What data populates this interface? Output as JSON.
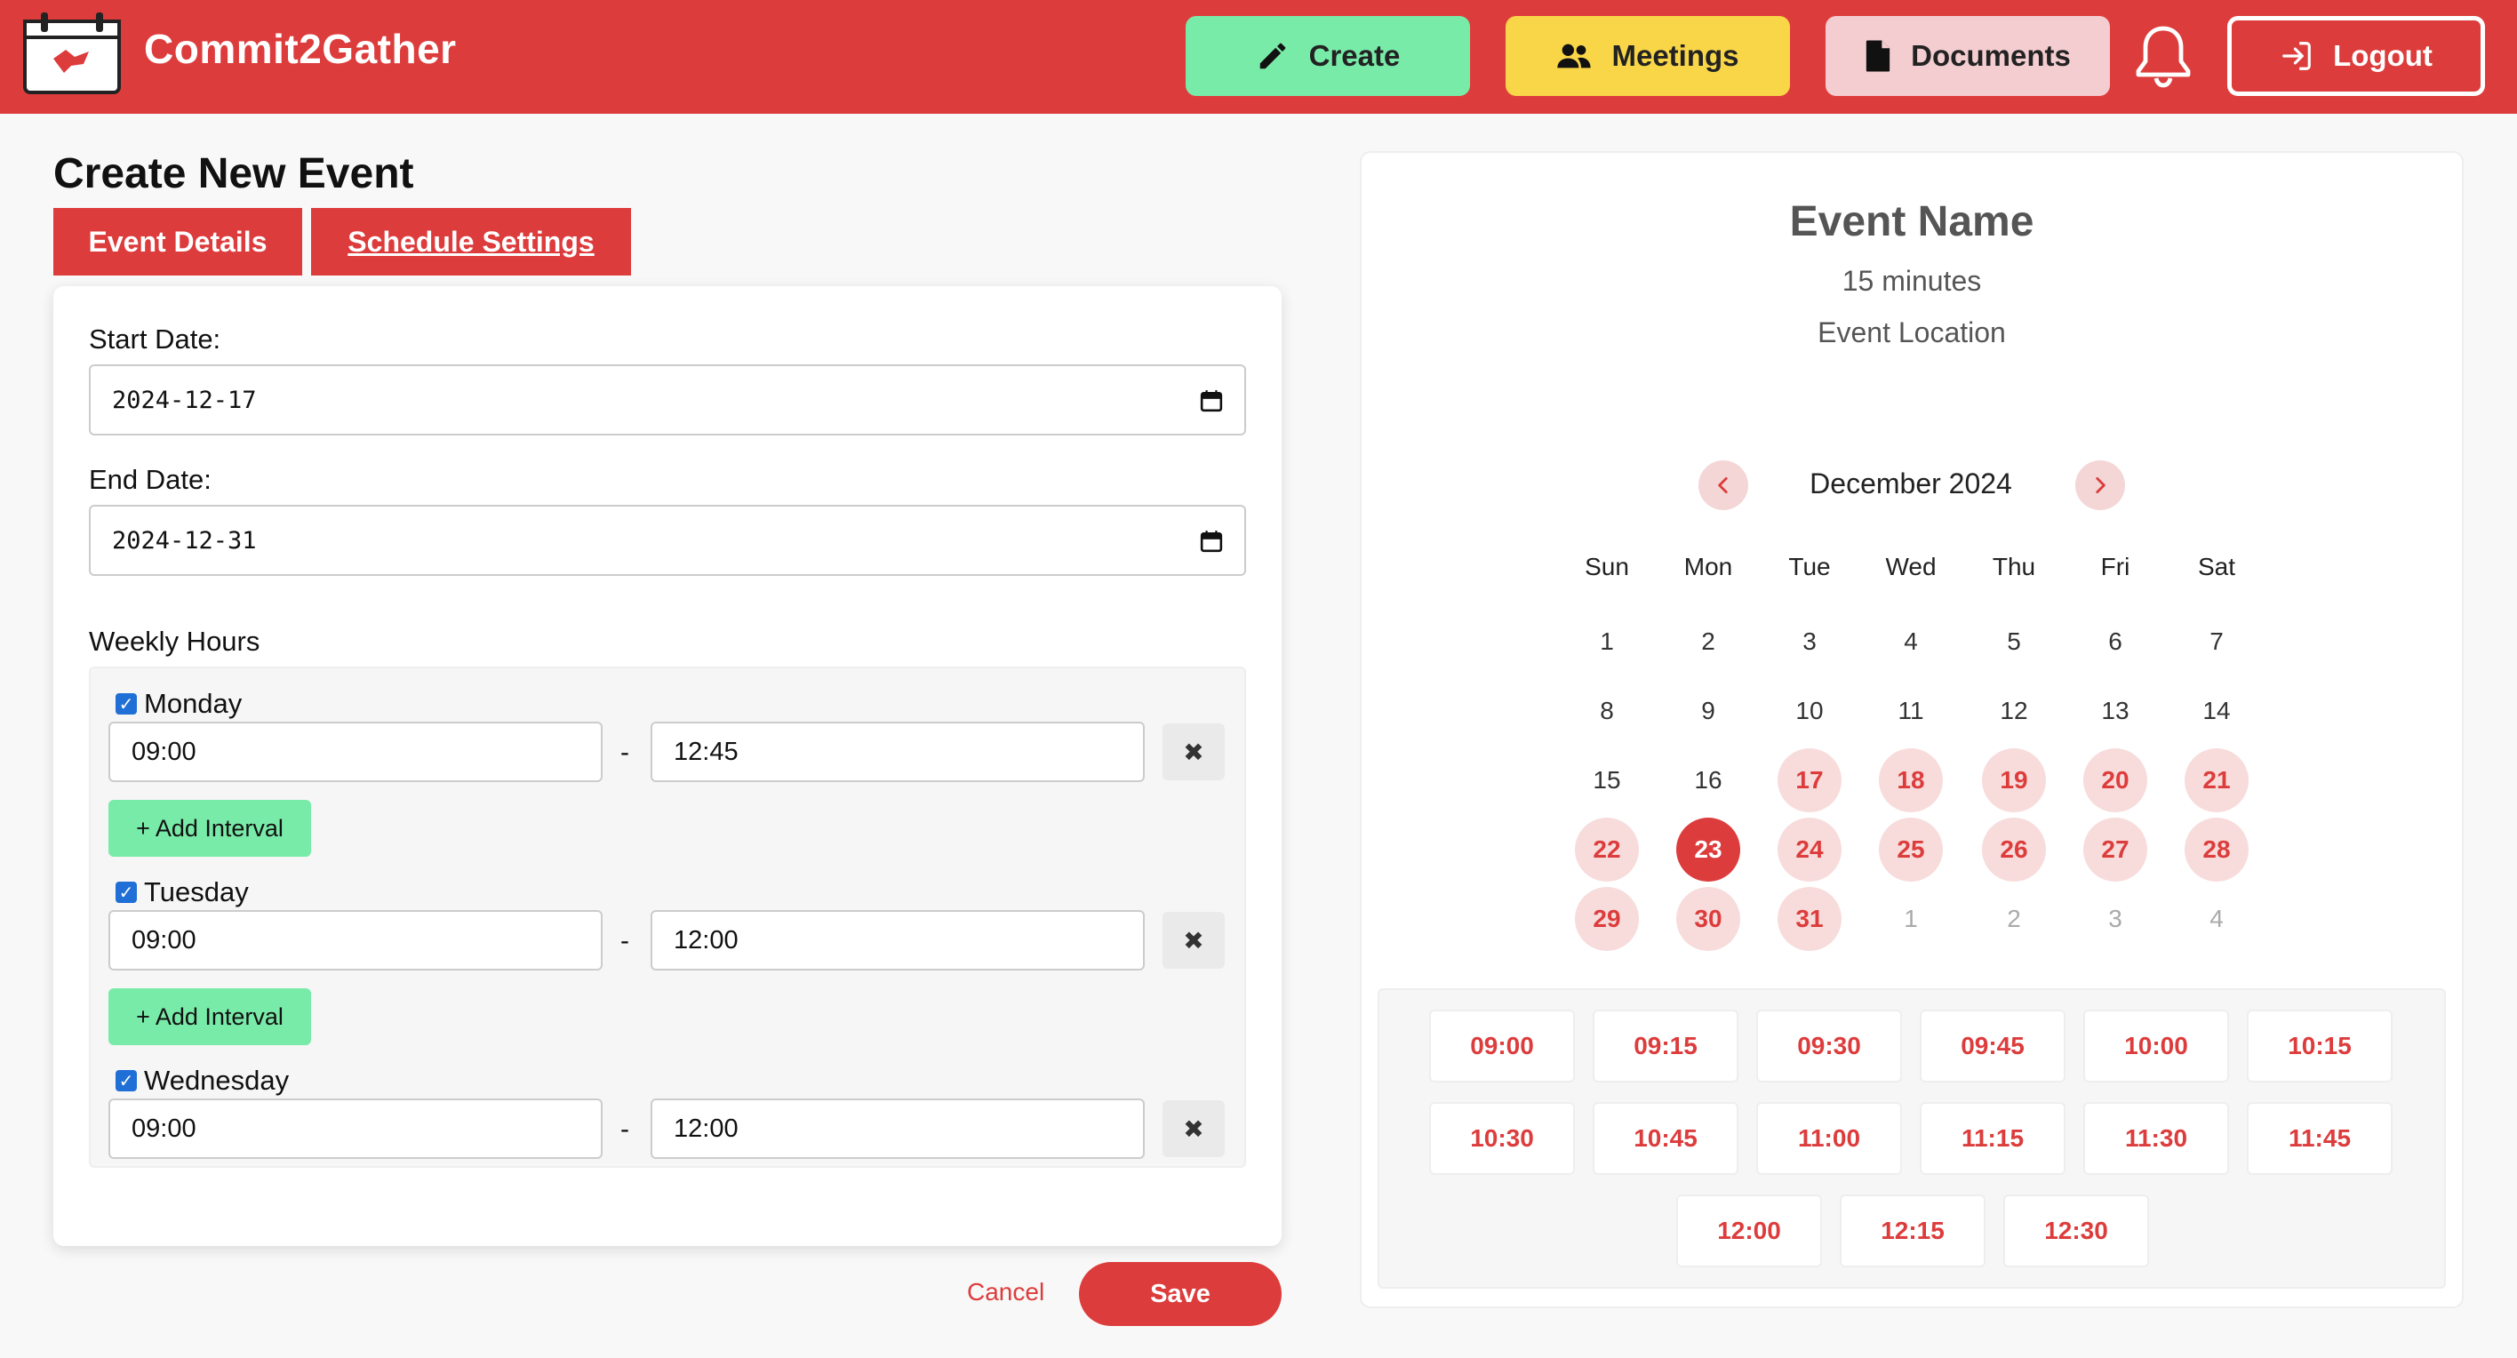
{
  "header": {
    "app_name": "Commit2Gather",
    "nav": {
      "create": "Create",
      "meetings": "Meetings",
      "documents": "Documents",
      "logout": "Logout"
    }
  },
  "form": {
    "title": "Create New Event",
    "tabs": [
      "Event Details",
      "Schedule Settings"
    ],
    "start_date_label": "Start Date:",
    "start_date_value": "2024-12-17",
    "end_date_label": "End Date:",
    "end_date_value": "2024-12-31",
    "weekly_hours_label": "Weekly Hours",
    "days": [
      {
        "name": "Monday",
        "checked": true,
        "from": "09:00",
        "to": "12:45"
      },
      {
        "name": "Tuesday",
        "checked": true,
        "from": "09:00",
        "to": "12:00"
      },
      {
        "name": "Wednesday",
        "checked": true,
        "from": "09:00",
        "to": "12:00"
      }
    ],
    "add_interval_label": "+ Add Interval",
    "separator": "-",
    "remove_glyph": "✖",
    "cancel": "Cancel",
    "save": "Save"
  },
  "preview": {
    "event_name": "Event Name",
    "duration": "15 minutes",
    "location": "Event Location",
    "month": "December 2024",
    "weekdays": [
      "Sun",
      "Mon",
      "Tue",
      "Wed",
      "Thu",
      "Fri",
      "Sat"
    ],
    "weeks": [
      [
        {
          "d": "1",
          "s": "normal"
        },
        {
          "d": "2",
          "s": "normal"
        },
        {
          "d": "3",
          "s": "normal"
        },
        {
          "d": "4",
          "s": "normal"
        },
        {
          "d": "5",
          "s": "normal"
        },
        {
          "d": "6",
          "s": "normal"
        },
        {
          "d": "7",
          "s": "normal"
        }
      ],
      [
        {
          "d": "8",
          "s": "normal"
        },
        {
          "d": "9",
          "s": "normal"
        },
        {
          "d": "10",
          "s": "normal"
        },
        {
          "d": "11",
          "s": "normal"
        },
        {
          "d": "12",
          "s": "normal"
        },
        {
          "d": "13",
          "s": "normal"
        },
        {
          "d": "14",
          "s": "normal"
        }
      ],
      [
        {
          "d": "15",
          "s": "normal"
        },
        {
          "d": "16",
          "s": "normal"
        },
        {
          "d": "17",
          "s": "avail"
        },
        {
          "d": "18",
          "s": "avail"
        },
        {
          "d": "19",
          "s": "avail"
        },
        {
          "d": "20",
          "s": "avail"
        },
        {
          "d": "21",
          "s": "avail"
        }
      ],
      [
        {
          "d": "22",
          "s": "avail"
        },
        {
          "d": "23",
          "s": "selected"
        },
        {
          "d": "24",
          "s": "avail"
        },
        {
          "d": "25",
          "s": "avail"
        },
        {
          "d": "26",
          "s": "avail"
        },
        {
          "d": "27",
          "s": "avail"
        },
        {
          "d": "28",
          "s": "avail"
        }
      ],
      [
        {
          "d": "29",
          "s": "avail"
        },
        {
          "d": "30",
          "s": "avail"
        },
        {
          "d": "31",
          "s": "avail"
        },
        {
          "d": "1",
          "s": "other"
        },
        {
          "d": "2",
          "s": "other"
        },
        {
          "d": "3",
          "s": "other"
        },
        {
          "d": "4",
          "s": "other"
        }
      ]
    ],
    "time_slots": [
      "09:00",
      "09:15",
      "09:30",
      "09:45",
      "10:00",
      "10:15",
      "10:30",
      "10:45",
      "11:00",
      "11:15",
      "11:30",
      "11:45",
      "12:00",
      "12:15",
      "12:30"
    ]
  },
  "colors": {
    "brand_red": "#dd3c3c",
    "create_green": "#79eba9",
    "meetings_yellow": "#f9d648",
    "documents_pink": "#f4cdd0"
  },
  "icons": [
    "calendar-logo-icon",
    "pencil-icon",
    "users-icon",
    "document-icon",
    "bell-icon",
    "logout-icon",
    "calendar-icon",
    "chevron-left-icon",
    "chevron-right-icon",
    "close-icon"
  ]
}
